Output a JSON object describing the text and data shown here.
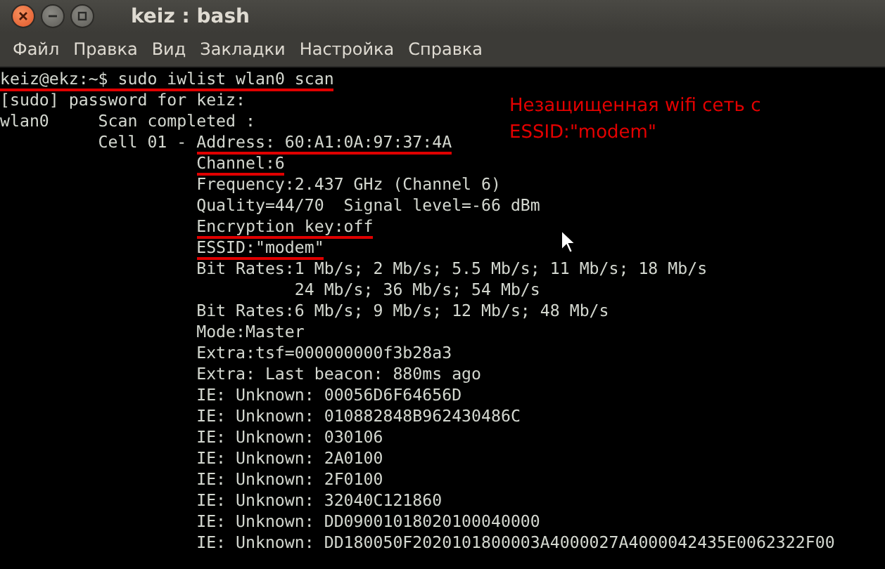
{
  "window": {
    "title": "keiz : bash"
  },
  "menu": [
    "Файл",
    "Правка",
    "Вид",
    "Закладки",
    "Настройка",
    "Справка"
  ],
  "terminal_lines": [
    {
      "kind": "plain",
      "text": "keiz@ekz:~$ sudo iwlist wlan0 scan",
      "underlined": true
    },
    {
      "kind": "plain",
      "text": "[sudo] password for keiz:",
      "underlined": false
    },
    {
      "kind": "plain",
      "text": "wlan0     Scan completed :",
      "underlined": false
    },
    {
      "kind": "cell",
      "prefix": "Cell 01 - ",
      "text": "Address: 60:A1:0A:97:37:4A",
      "underlined": true
    },
    {
      "kind": "field",
      "text": "Channel:6",
      "underlined": true
    },
    {
      "kind": "field",
      "text": "Frequency:2.437 GHz (Channel 6)",
      "underlined": false
    },
    {
      "kind": "field",
      "text": "Quality=44/70  Signal level=-66 dBm",
      "underlined": false
    },
    {
      "kind": "field",
      "text": "Encryption key:off",
      "underlined": true
    },
    {
      "kind": "field",
      "text": "ESSID:\"modem\"",
      "underlined": true
    },
    {
      "kind": "field",
      "text": "Bit Rates:1 Mb/s; 2 Mb/s; 5.5 Mb/s; 11 Mb/s; 18 Mb/s",
      "underlined": false
    },
    {
      "kind": "continuation",
      "text": "24 Mb/s; 36 Mb/s; 54 Mb/s",
      "underlined": false
    },
    {
      "kind": "field",
      "text": "Bit Rates:6 Mb/s; 9 Mb/s; 12 Mb/s; 48 Mb/s",
      "underlined": false
    },
    {
      "kind": "field",
      "text": "Mode:Master",
      "underlined": false
    },
    {
      "kind": "field",
      "text": "Extra:tsf=000000000f3b28a3",
      "underlined": false
    },
    {
      "kind": "field",
      "text": "Extra: Last beacon: 880ms ago",
      "underlined": false
    },
    {
      "kind": "field",
      "text": "IE: Unknown: 00056D6F64656D",
      "underlined": false
    },
    {
      "kind": "field",
      "text": "IE: Unknown: 010882848B962430486C",
      "underlined": false
    },
    {
      "kind": "field",
      "text": "IE: Unknown: 030106",
      "underlined": false
    },
    {
      "kind": "field",
      "text": "IE: Unknown: 2A0100",
      "underlined": false
    },
    {
      "kind": "field",
      "text": "IE: Unknown: 2F0100",
      "underlined": false
    },
    {
      "kind": "field",
      "text": "IE: Unknown: 32040C121860",
      "underlined": false
    },
    {
      "kind": "field",
      "text": "IE: Unknown: DD09001018020100040000",
      "underlined": false
    },
    {
      "kind": "field",
      "text": "IE: Unknown: DD180050F2020101800003A4000027A4000042435E0062322F00",
      "underlined": false
    }
  ],
  "annotation": [
    "Незащищенная wifi сеть с",
    "ESSID:\"modem\""
  ]
}
